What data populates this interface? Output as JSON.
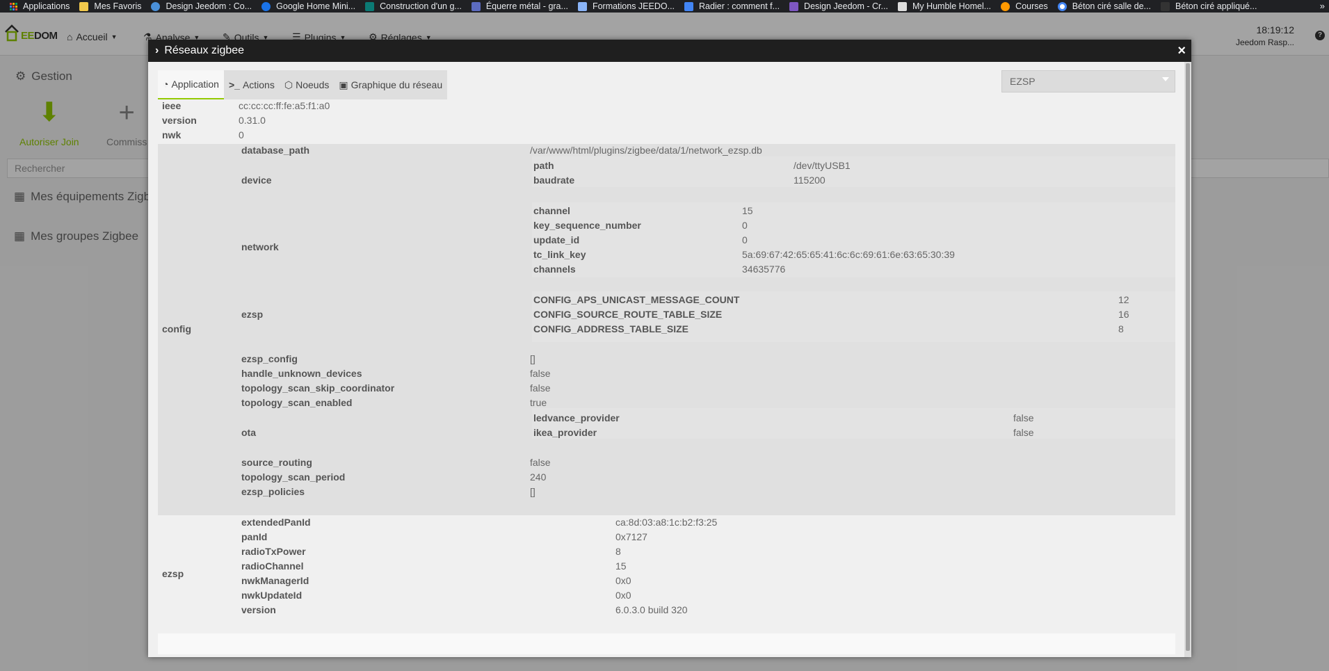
{
  "bookmarks": [
    {
      "label": "Applications",
      "color": "#e8453c"
    },
    {
      "label": "Mes Favoris",
      "color": "#f2c94c"
    },
    {
      "label": "Design Jeedom : Co...",
      "color": "#4a90d9"
    },
    {
      "label": "Google Home Mini...",
      "color": "#1a73e8"
    },
    {
      "label": "Construction d'un g...",
      "color": "#0b7a75"
    },
    {
      "label": "Équerre métal - gra...",
      "color": "#5c6bc0"
    },
    {
      "label": "Formations JEEDO...",
      "color": "#8ab4f8"
    },
    {
      "label": "Radier : comment f...",
      "color": "#4285f4"
    },
    {
      "label": "Design Jeedom - Cr...",
      "color": "#7e57c2"
    },
    {
      "label": "My Humble Homel...",
      "color": "#dddddd"
    },
    {
      "label": "Courses",
      "color": "#ff9900"
    },
    {
      "label": "Béton ciré salle de...",
      "color": "#ffffff"
    },
    {
      "label": "Béton ciré appliqué...",
      "color": "#333333"
    }
  ],
  "navbar": {
    "logo_text_green": "EE",
    "logo_text_dark": "DOM",
    "menu": [
      {
        "label": "Accueil",
        "icon": "home-icon"
      },
      {
        "label": "Analyse",
        "icon": "analyse-icon"
      },
      {
        "label": "Outils",
        "icon": "wrench-icon"
      },
      {
        "label": "Plugins",
        "icon": "list-icon"
      },
      {
        "label": "Réglages",
        "icon": "gear-icon"
      }
    ],
    "time": "18:19:12",
    "host": "Jeedom Rasp..."
  },
  "background": {
    "gestion": "Gestion",
    "actions": [
      "Autoriser Join",
      "Commiss"
    ],
    "search_placeholder": "Rechercher",
    "sections": [
      "Mes équipements Zigb",
      "Mes groupes Zigbee"
    ]
  },
  "modal": {
    "title": "Réseaux zigbee",
    "close": "×",
    "tabs": [
      {
        "label": "Application",
        "icon": "dashboard-icon",
        "active": true
      },
      {
        "label": "Actions",
        "icon": "terminal-icon",
        "active": false
      },
      {
        "label": "Noeuds",
        "icon": "nodes-icon",
        "active": false
      },
      {
        "label": "Graphique du réseau",
        "icon": "image-icon",
        "active": false
      }
    ],
    "select_value": "EZSP",
    "top": [
      {
        "k": "ieee",
        "v": "cc:cc:cc:ff:fe:a5:f1:a0"
      },
      {
        "k": "version",
        "v": "0.31.0"
      },
      {
        "k": "nwk",
        "v": "0"
      }
    ],
    "config": {
      "label": "config",
      "database_path": {
        "k": "database_path",
        "v": "/var/www/html/plugins/zigbee/data/1/network_ezsp.db"
      },
      "device": {
        "k": "device",
        "path": {
          "k": "path",
          "v": "/dev/ttyUSB1"
        },
        "baudrate": {
          "k": "baudrate",
          "v": "115200"
        }
      },
      "network": {
        "k": "network",
        "items": [
          {
            "k": "channel",
            "v": "15"
          },
          {
            "k": "key_sequence_number",
            "v": "0"
          },
          {
            "k": "update_id",
            "v": "0"
          },
          {
            "k": "tc_link_key",
            "v": "5a:69:67:42:65:65:41:6c:6c:69:61:6e:63:65:30:39"
          },
          {
            "k": "channels",
            "v": "34635776"
          }
        ]
      },
      "ezsp": {
        "k": "ezsp",
        "items": [
          {
            "k": "CONFIG_APS_UNICAST_MESSAGE_COUNT",
            "v": "12"
          },
          {
            "k": "CONFIG_SOURCE_ROUTE_TABLE_SIZE",
            "v": "16"
          },
          {
            "k": "CONFIG_ADDRESS_TABLE_SIZE",
            "v": "8"
          }
        ]
      },
      "simple1": [
        {
          "k": "ezsp_config",
          "v": "[]"
        },
        {
          "k": "handle_unknown_devices",
          "v": "false"
        },
        {
          "k": "topology_scan_skip_coordinator",
          "v": "false"
        },
        {
          "k": "topology_scan_enabled",
          "v": "true"
        }
      ],
      "ota": {
        "k": "ota",
        "items": [
          {
            "k": "ledvance_provider",
            "v": "false"
          },
          {
            "k": "ikea_provider",
            "v": "false"
          }
        ]
      },
      "simple2": [
        {
          "k": "source_routing",
          "v": "false"
        },
        {
          "k": "topology_scan_period",
          "v": "240"
        },
        {
          "k": "ezsp_policies",
          "v": "[]"
        }
      ]
    },
    "ezsp": {
      "label": "ezsp",
      "items": [
        {
          "k": "extendedPanId",
          "v": "ca:8d:03:a8:1c:b2:f3:25"
        },
        {
          "k": "panId",
          "v": "0x7127"
        },
        {
          "k": "radioTxPower",
          "v": "8"
        },
        {
          "k": "radioChannel",
          "v": "15"
        },
        {
          "k": "nwkManagerId",
          "v": "0x0"
        },
        {
          "k": "nwkUpdateId",
          "v": "0x0"
        },
        {
          "k": "version",
          "v": "6.0.3.0 build 320"
        }
      ]
    }
  }
}
